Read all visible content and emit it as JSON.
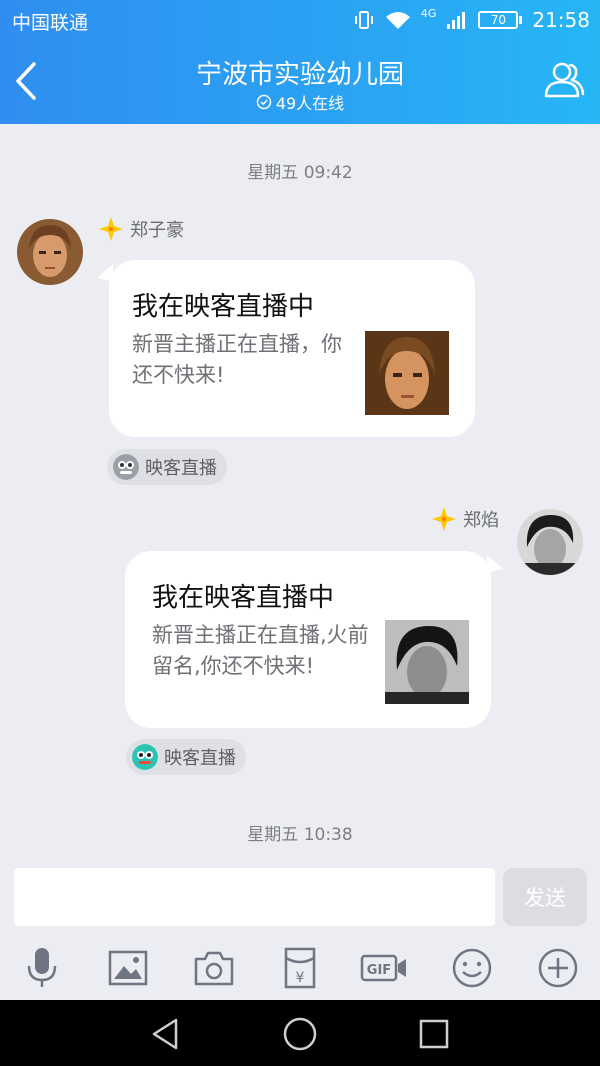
{
  "status_bar": {
    "carrier": "中国联通",
    "network": "4G",
    "battery": "70",
    "time": "21:58"
  },
  "header": {
    "title": "宁波市实验幼儿园",
    "online": "49人在线"
  },
  "chat": {
    "timestamp_1": "星期五 09:42",
    "timestamp_2": "星期五 10:38",
    "messages": [
      {
        "sender": "郑子豪",
        "side": "left",
        "card_title": "我在映客直播中",
        "card_text": "新晋主播正在直播，你还不快来!",
        "source": "映客直播"
      },
      {
        "sender": "郑焰",
        "side": "right",
        "card_title": "我在映客直播中",
        "card_text": "新晋主播正在直播,火前留名,你还不快来!",
        "source": "映客直播"
      }
    ]
  },
  "input": {
    "placeholder": "",
    "send_label": "发送"
  },
  "toolbar": [
    "microphone-icon",
    "image-icon",
    "camera-icon",
    "red-packet-icon",
    "gif-icon",
    "emoji-icon",
    "plus-icon"
  ],
  "colors": {
    "header_start": "#2f8ef0",
    "header_end": "#26b6f6",
    "background": "#ebedf2",
    "star": "#ffc800"
  }
}
